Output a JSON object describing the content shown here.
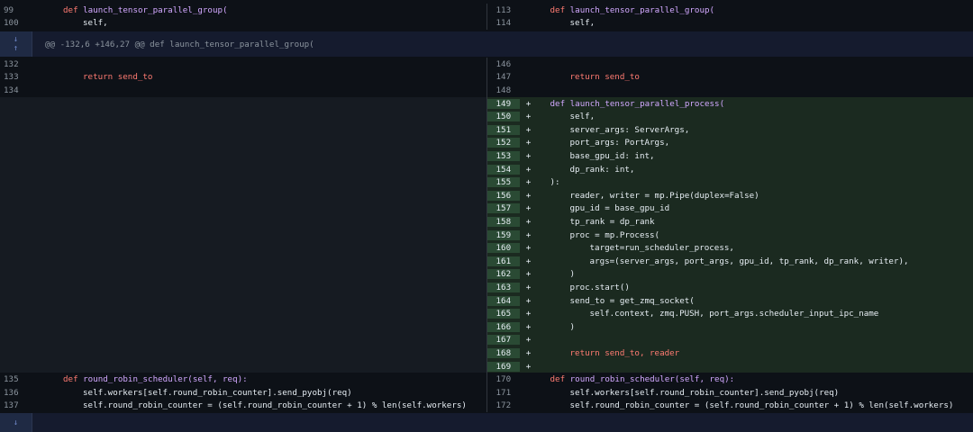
{
  "top_rows": [
    {
      "left_num": "99",
      "right_num": "113",
      "code": "def launch_tensor_parallel_group("
    },
    {
      "left_num": "100",
      "right_num": "114",
      "code": "self,"
    }
  ],
  "hunk1": {
    "text": "@@ -132,6 +146,27 @@ def launch_tensor_parallel_group("
  },
  "context1": [
    {
      "left_num": "132",
      "right_num": "146",
      "code": ""
    },
    {
      "left_num": "133",
      "right_num": "147",
      "code": "return send_to"
    },
    {
      "left_num": "134",
      "right_num": "148",
      "code": ""
    }
  ],
  "added": [
    {
      "num": "149",
      "code": "def launch_tensor_parallel_process("
    },
    {
      "num": "150",
      "code": "self,"
    },
    {
      "num": "151",
      "code": "server_args: ServerArgs,"
    },
    {
      "num": "152",
      "code": "port_args: PortArgs,"
    },
    {
      "num": "153",
      "code": "base_gpu_id: int,"
    },
    {
      "num": "154",
      "code": "dp_rank: int,"
    },
    {
      "num": "155",
      "code": "):"
    },
    {
      "num": "156",
      "code": "reader, writer = mp.Pipe(duplex=False)"
    },
    {
      "num": "157",
      "code": "gpu_id = base_gpu_id"
    },
    {
      "num": "158",
      "code": "tp_rank = dp_rank"
    },
    {
      "num": "159",
      "code": "proc = mp.Process("
    },
    {
      "num": "160",
      "code": "target=run_scheduler_process,"
    },
    {
      "num": "161",
      "code": "args=(server_args, port_args, gpu_id, tp_rank, dp_rank, writer),"
    },
    {
      "num": "162",
      "code": ")"
    },
    {
      "num": "163",
      "code": "proc.start()"
    },
    {
      "num": "164",
      "code": "send_to = get_zmq_socket("
    },
    {
      "num": "165",
      "code": "self.context, zmq.PUSH, port_args.scheduler_input_ipc_name"
    },
    {
      "num": "166",
      "code": ")"
    },
    {
      "num": "167",
      "code": ""
    },
    {
      "num": "168",
      "code": "return send_to, reader"
    },
    {
      "num": "169",
      "code": ""
    }
  ],
  "added_marker": "+",
  "context2": [
    {
      "left_num": "135",
      "right_num": "170",
      "code": "def round_robin_scheduler(self, req):"
    },
    {
      "left_num": "136",
      "right_num": "171",
      "code": "self.workers[self.round_robin_counter].send_pyobj(req)"
    },
    {
      "left_num": "137",
      "right_num": "172",
      "code": "self.round_robin_counter = (self.round_robin_counter + 1) % len(self.workers)"
    }
  ],
  "expand_icons": {
    "up": "↑",
    "down": "↓",
    "expand_both": "⇕"
  },
  "colors": {
    "bg": "#0d1117",
    "added_bg": "#1b2a20",
    "added_gutter": "#2a4a34",
    "hunk_bg": "#151b2e",
    "keyword": "#ff7b72",
    "function": "#d2a8ff",
    "builtin": "#79c0ff"
  }
}
